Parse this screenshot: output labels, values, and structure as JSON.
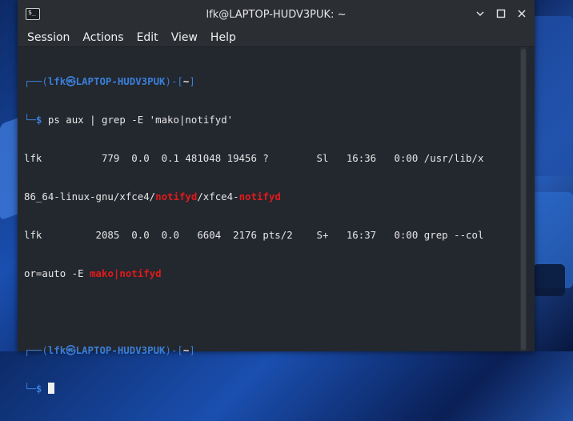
{
  "window": {
    "title": "lfk@LAPTOP-HUDV3PUK: ~",
    "app_icon_glyph": "$_"
  },
  "menubar": {
    "items": [
      "Session",
      "Actions",
      "Edit",
      "View",
      "Help"
    ]
  },
  "prompt": {
    "top_left": "┌──(",
    "user_host": "lfk㉿LAPTOP-HUDV3PUK",
    "middle": ")-[",
    "cwd": "~",
    "end": "]",
    "bottom_left": "└─",
    "symbol": "$"
  },
  "terminal": {
    "command": "ps aux | grep -E 'mako|notifyd'",
    "row1_a": "lfk          779  0.0  0.1 481048 19456 ?        Sl   16:36   0:00 /usr/lib/x",
    "row1_b1": "86_64-linux-gnu/xfce4/",
    "row1_b2": "notifyd",
    "row1_b3": "/xfce4-",
    "row1_b4": "notifyd",
    "row2_a": "lfk         2085  0.0  0.0   6604  2176 pts/2    S+   16:37   0:00 grep --col",
    "row2_b1": "or=auto -E ",
    "row2_b2": "mako",
    "row2_b3": "|",
    "row2_b4": "notifyd"
  },
  "colors": {
    "prompt_blue": "#3a7fd9",
    "match_red": "#e01b1b",
    "terminal_bg": "#23272e"
  }
}
